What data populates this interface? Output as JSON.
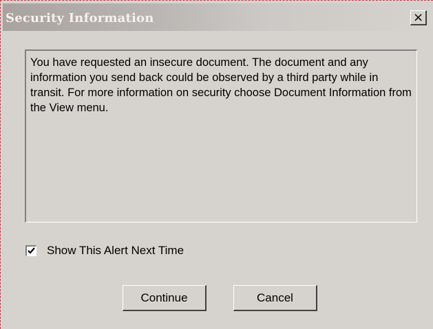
{
  "window": {
    "title": "Security Information",
    "close_glyph": "×",
    "close_icon": "close-icon"
  },
  "message": {
    "text": "You have requested an insecure document. The document and any information you send back could be observed by a third party while in transit. For more information on security choose Document Information from the View menu."
  },
  "alert_option": {
    "label": "Show This Alert Next Time",
    "checked": true,
    "icon": "checkmark-icon"
  },
  "buttons": {
    "continue_label": "Continue",
    "cancel_label": "Cancel"
  },
  "colors": {
    "dialog_background": "#d6d3ce",
    "title_text": "#f4f1ee",
    "frame_border": "#c0384b"
  }
}
